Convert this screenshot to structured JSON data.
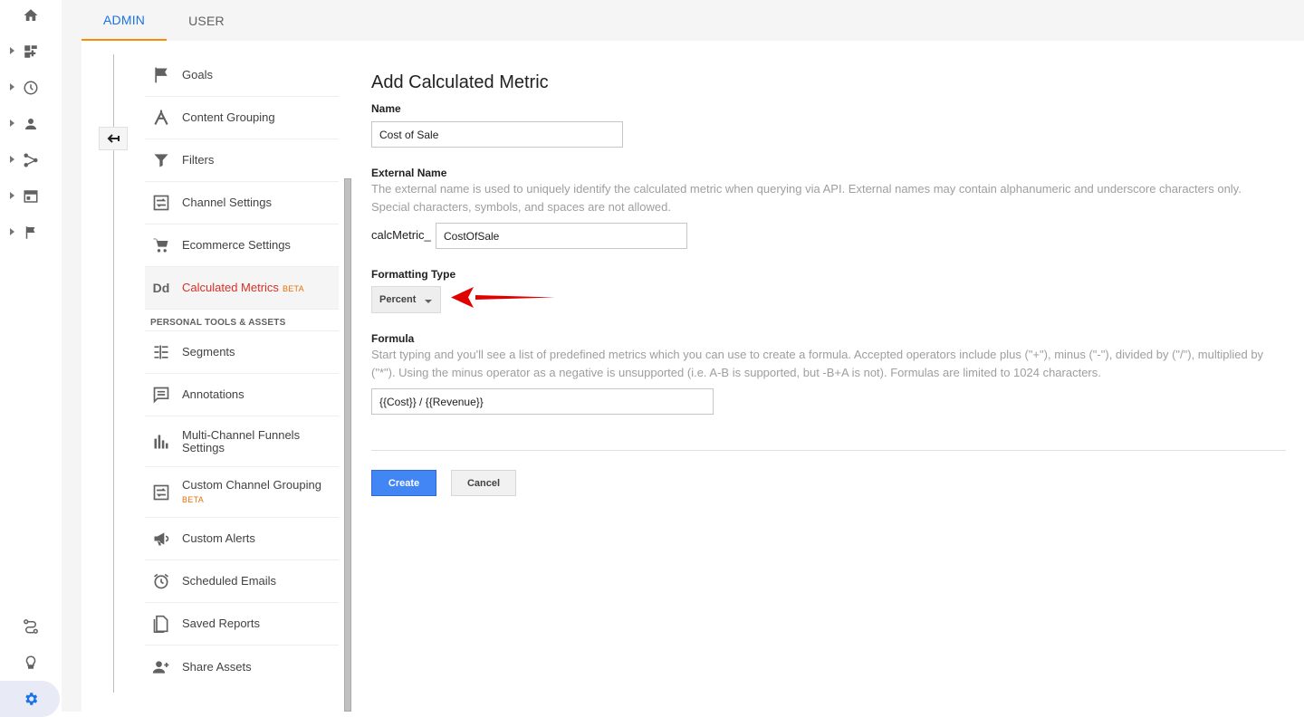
{
  "tabs": [
    {
      "label": "ADMIN",
      "active": true
    },
    {
      "label": "USER",
      "active": false
    }
  ],
  "rail": {
    "items": [
      "home-icon",
      "customization-icon",
      "realtime-icon",
      "audience-icon",
      "acquisition-icon",
      "behavior-icon",
      "conversions-icon"
    ],
    "bottom": [
      "discover-icon",
      "lightbulb-icon",
      "gear-icon"
    ]
  },
  "nav": {
    "items": [
      {
        "label": "Goals",
        "icon": "flag-icon"
      },
      {
        "label": "Content Grouping",
        "icon": "content-grouping-icon"
      },
      {
        "label": "Filters",
        "icon": "filter-icon"
      },
      {
        "label": "Channel Settings",
        "icon": "channel-settings-icon"
      },
      {
        "label": "Ecommerce Settings",
        "icon": "cart-icon"
      },
      {
        "label": "Calculated Metrics",
        "icon": "dd-icon",
        "badge": "BETA",
        "active": true
      }
    ],
    "section_title": "PERSONAL TOOLS & ASSETS",
    "personal_items": [
      {
        "label": "Segments",
        "icon": "segments-icon"
      },
      {
        "label": "Annotations",
        "icon": "annotations-icon"
      },
      {
        "label": "Multi-Channel Funnels Settings",
        "icon": "funnels-icon"
      },
      {
        "label": "Custom Channel Grouping",
        "icon": "custom-channel-icon",
        "badge": "BETA"
      },
      {
        "label": "Custom Alerts",
        "icon": "megaphone-icon"
      },
      {
        "label": "Scheduled Emails",
        "icon": "alarm-icon"
      },
      {
        "label": "Saved Reports",
        "icon": "document-icon"
      },
      {
        "label": "Share Assets",
        "icon": "add-person-icon"
      }
    ]
  },
  "form": {
    "title": "Add Calculated Metric",
    "name_label": "Name",
    "name_value": "Cost of Sale",
    "external_label": "External Name",
    "external_help": "The external name is used to uniquely identify the calculated metric when querying via API. External names may contain alphanumeric and underscore characters only. Special characters, symbols, and spaces are not allowed.",
    "external_prefix": "calcMetric_",
    "external_value": "CostOfSale",
    "formatting_label": "Formatting Type",
    "formatting_value": "Percent",
    "formula_label": "Formula",
    "formula_help": "Start typing and you'll see a list of predefined metrics which you can use to create a formula. Accepted operators include plus (\"+\"), minus (\"-\"), divided by (\"/\"), multiplied by (\"*\"). Using the minus operator as a negative is unsupported (i.e. A-B is supported, but -B+A is not). Formulas are limited to 1024 characters.",
    "formula_value": "{{Cost}} / {{Revenue}}",
    "create_label": "Create",
    "cancel_label": "Cancel"
  },
  "colors": {
    "accent_blue": "#1a73e8",
    "tab_underline": "#fb8c00",
    "active_nav": "#d93025",
    "beta": "#e8710a",
    "create_button": "#4285f4",
    "annotation_arrow": "#e00000"
  }
}
